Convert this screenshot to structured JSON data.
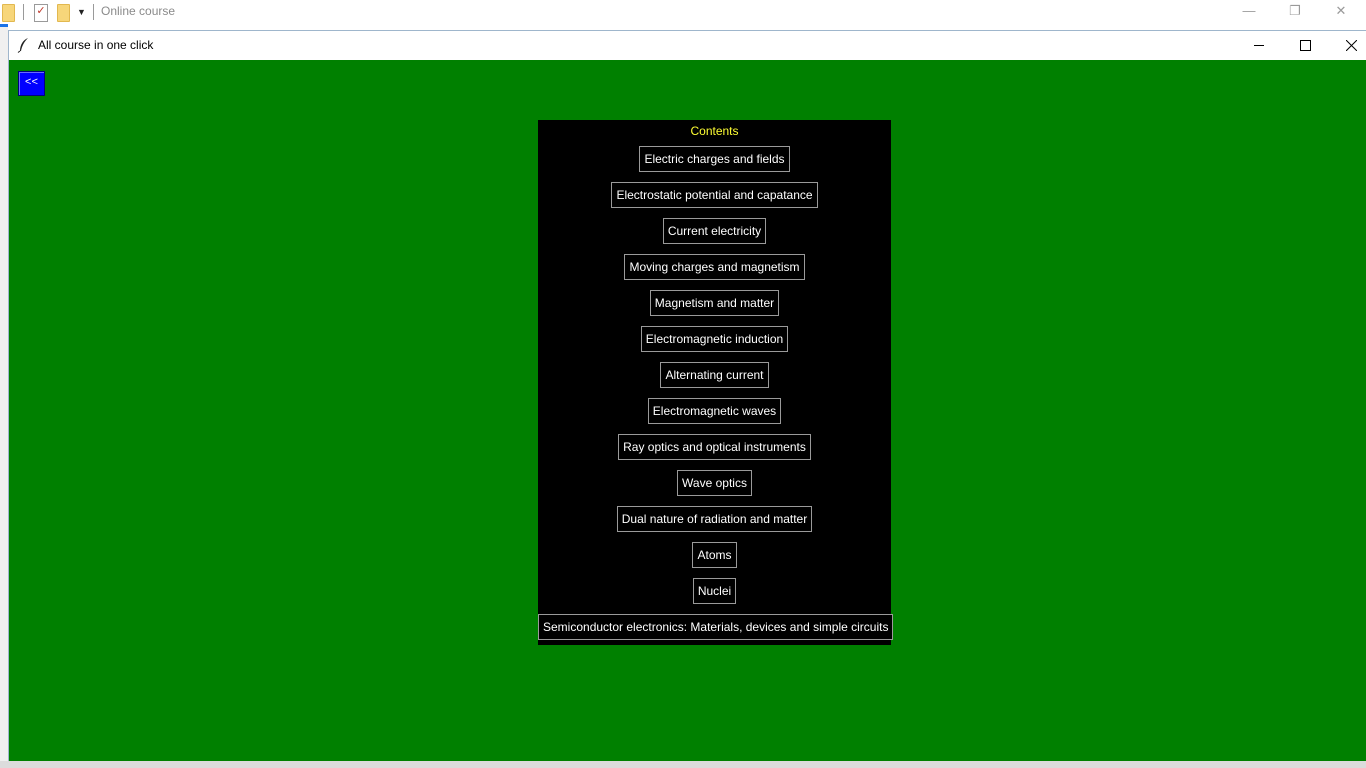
{
  "background_window": {
    "title": "Online course"
  },
  "app": {
    "title": "All course in one click",
    "back_label": "<<",
    "colors": {
      "client_bg": "#008000",
      "panel_bg": "#000000",
      "heading": "#ffff33",
      "back_button": "#0000ff"
    },
    "contents": {
      "heading": "Contents",
      "items": [
        "Electric charges and fields",
        "Electrostatic potential and capatance",
        "Current electricity",
        "Moving charges and magnetism",
        "Magnetism and matter",
        "Electromagnetic induction",
        "Alternating current",
        "Electromagnetic waves",
        "Ray optics and optical instruments",
        "Wave optics",
        "Dual nature of radiation and matter",
        "Atoms",
        "Nuclei",
        "Semiconductor electronics: Materials, devices and simple circuits"
      ]
    }
  }
}
